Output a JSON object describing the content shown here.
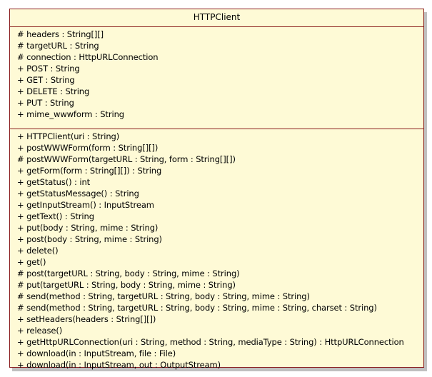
{
  "class_name": "HTTPClient",
  "attributes": [
    "# headers : String[][]",
    "# targetURL : String",
    "# connection : HttpURLConnection",
    "+ POST : String",
    "+ GET : String",
    "+ DELETE : String",
    "+ PUT : String",
    "+ mime_wwwform : String"
  ],
  "operations": [
    "+ HTTPClient(uri : String)",
    "+ postWWWForm(form : String[][])",
    "# postWWWForm(targetURL : String, form : String[][])",
    "+ getForm(form : String[][]) : String",
    "+ getStatus() : int",
    "+ getStatusMessage() : String",
    "+ getInputStream() : InputStream",
    "+ getText() : String",
    "+ put(body : String, mime : String)",
    "+ post(body : String, mime : String)",
    "+ delete()",
    "+ get()",
    "# post(targetURL : String, body : String, mime : String)",
    "# put(targetURL : String, body : String, mime : String)",
    "# send(method : String, targetURL : String, body : String, mime : String)",
    "# send(method : String, targetURL : String, body : String, mime : String, charset : String)",
    "+ setHeaders(headers : String[][])",
    "+ release()",
    "+ getHttpURLConnection(uri : String, method : String, mediaType : String) : HttpURLConnection",
    "+ download(in : InputStream, file : File)",
    "+ download(in : InputStream, out : OutputStream)"
  ]
}
